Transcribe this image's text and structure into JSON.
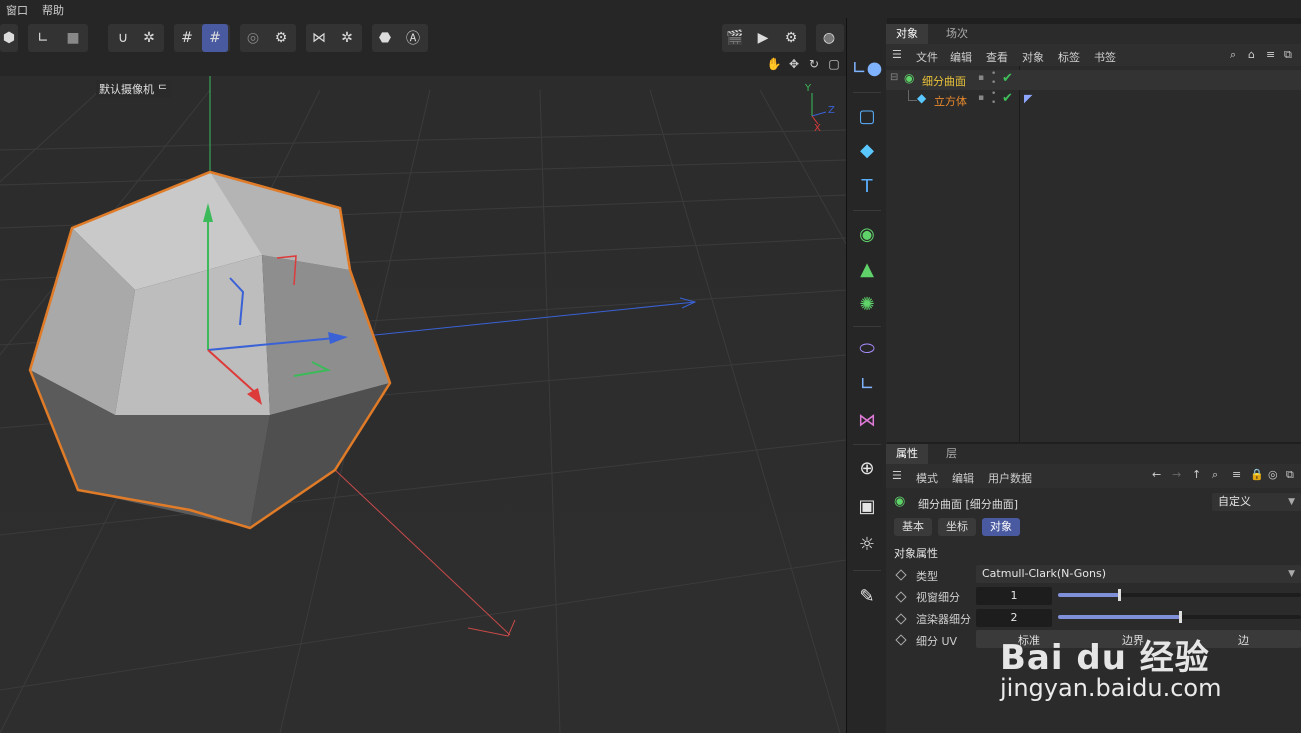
{
  "menubar": {
    "items": [
      "窗口",
      "帮助"
    ]
  },
  "viewport": {
    "camera_label": "默认摄像机 ᄃ"
  },
  "axis_gizmo": {
    "y": "Y",
    "z": "Z",
    "x": "X"
  },
  "objects_panel": {
    "tabs": [
      "对象",
      "场次"
    ],
    "menu": [
      "文件",
      "编辑",
      "查看",
      "对象",
      "标签",
      "书签"
    ],
    "items": [
      {
        "name": "细分曲面",
        "color": "#e8c23a"
      },
      {
        "name": "立方体",
        "color": "#e8892c"
      }
    ]
  },
  "attr_panel": {
    "tabs": [
      "属性",
      "层"
    ],
    "menu": [
      "模式",
      "编辑",
      "用户数据"
    ],
    "object_title": "细分曲面 [细分曲面]",
    "preset": "自定义",
    "subtabs": [
      "基本",
      "坐标",
      "对象"
    ],
    "section_title": "对象属性",
    "fields": [
      {
        "label": "类型",
        "value": "Catmull-Clark(N-Gons)"
      },
      {
        "label": "视窗细分",
        "value": "1",
        "slider": 0.25
      },
      {
        "label": "渲染器细分",
        "value": "2",
        "slider": 0.5
      },
      {
        "label": "细分 UV",
        "options": [
          "标准",
          "边界",
          "边"
        ]
      }
    ]
  },
  "watermark": {
    "brand": "Bai du 经验",
    "url": "jingyan.baidu.com"
  },
  "colors": {
    "accent": "#4a5aa0",
    "selection": "#e07b28",
    "check": "#3ec15a"
  }
}
